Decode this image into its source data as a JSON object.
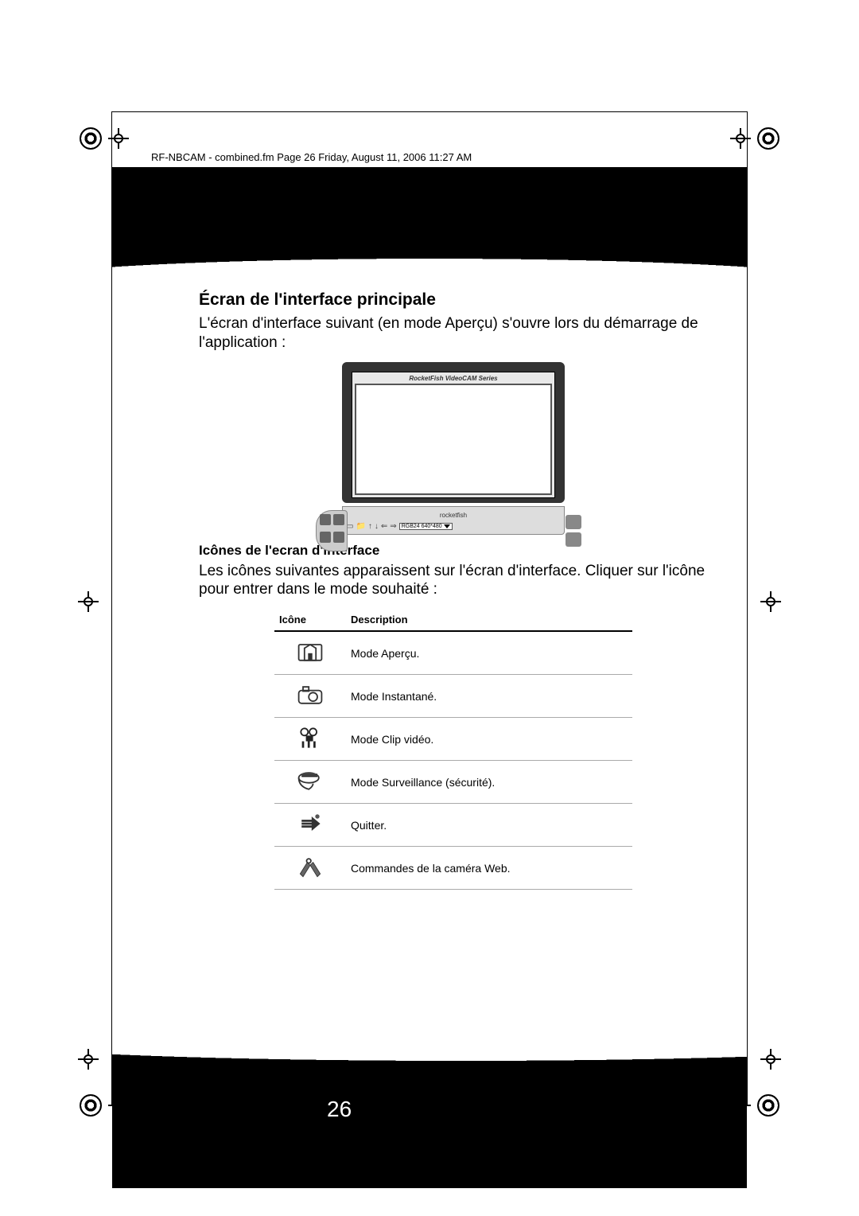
{
  "header_line": "RF-NBCAM - combined.fm  Page 26  Friday, August 11, 2006   11:27 AM",
  "page_number": "26",
  "section_title": "Écran de l'interface principale",
  "section_para": "L'écran d'interface suivant (en mode Aperçu) s'ouvre lors du démarrage de l'application :",
  "screenshot": {
    "title": "RocketFish VideoCAM Series",
    "brand": "rocketfish",
    "dropdown": "RGB24  640*480"
  },
  "subsection_title": "Icônes de l'ecran d'interface",
  "subsection_para": "Les icônes suivantes apparaissent sur l'écran d'interface. Cliquer sur l'icône pour entrer dans le mode souhaité :",
  "table": {
    "col_icon": "Icône",
    "col_desc": "Description",
    "rows": [
      {
        "icon": "preview",
        "desc": "Mode Aperçu."
      },
      {
        "icon": "snapshot",
        "desc": "Mode Instantané."
      },
      {
        "icon": "videoclip",
        "desc": "Mode Clip vidéo."
      },
      {
        "icon": "surveillance",
        "desc": "Mode Surveillance (sécurité)."
      },
      {
        "icon": "exit",
        "desc": "Quitter."
      },
      {
        "icon": "webcam-controls",
        "desc": "Commandes de la caméra Web."
      }
    ]
  }
}
